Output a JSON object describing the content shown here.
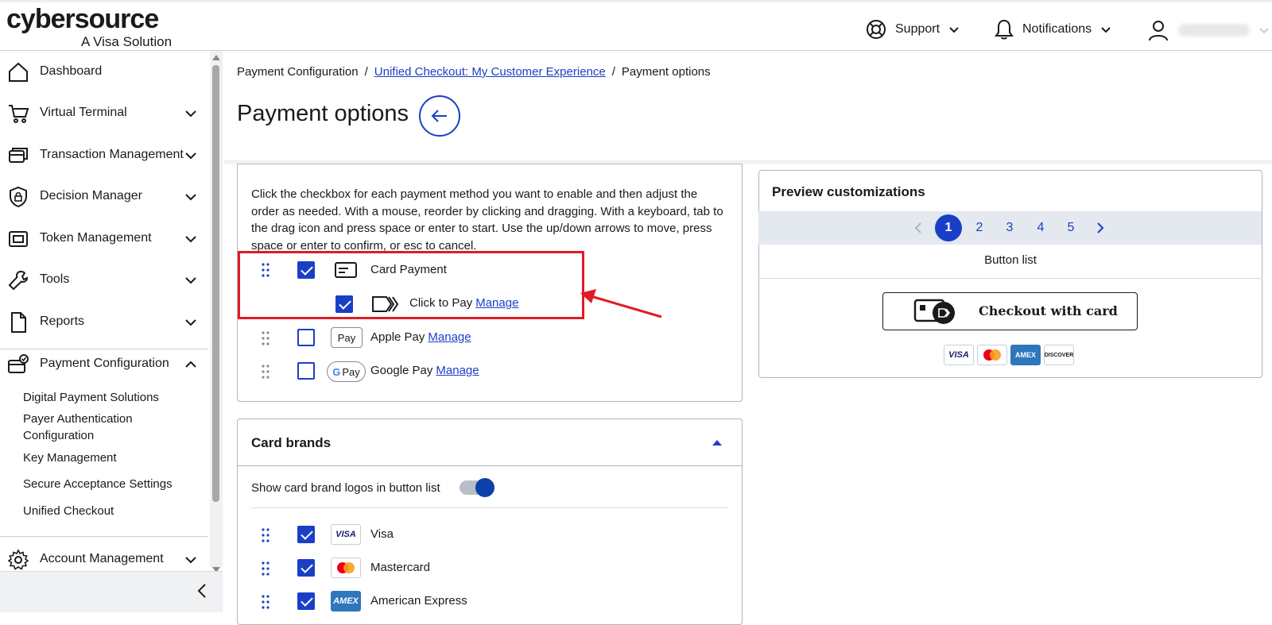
{
  "brand": {
    "name": "cybersource",
    "tagline": "A Visa Solution"
  },
  "topnav": {
    "support": "Support",
    "notifications": "Notifications"
  },
  "sidebar": {
    "items": [
      {
        "label": "Dashboard"
      },
      {
        "label": "Virtual Terminal"
      },
      {
        "label": "Transaction Management"
      },
      {
        "label": "Decision Manager"
      },
      {
        "label": "Token Management"
      },
      {
        "label": "Tools"
      },
      {
        "label": "Reports"
      },
      {
        "label": "Payment Configuration"
      },
      {
        "label": "Account Management"
      }
    ],
    "sub_items": [
      "Digital Payment Solutions",
      "Payer Authentication Configuration",
      "Key Management",
      "Secure Acceptance Settings",
      "Unified Checkout"
    ]
  },
  "breadcrumb": {
    "root": "Payment Configuration",
    "link": "Unified Checkout: My Customer Experience",
    "current": "Payment options"
  },
  "page_title": "Payment options",
  "methods": {
    "instructions": "Click the checkbox for each payment method you want to enable and then adjust the order as needed. With a mouse, reorder by clicking and dragging. With a keyboard, tab to the drag icon and press space or enter to start. Use the up/down arrows to move, press space or enter to confirm, or esc to cancel.",
    "card_payment": {
      "label": "Card Payment",
      "checked": true
    },
    "click_to_pay": {
      "label": "Click to Pay",
      "manage": "Manage",
      "checked": true
    },
    "apple_pay": {
      "label": "Apple Pay",
      "manage": "Manage",
      "checked": false,
      "badge": "Pay"
    },
    "google_pay": {
      "label": "Google Pay",
      "manage": "Manage",
      "checked": false,
      "badge": "Pay"
    }
  },
  "card_brands": {
    "title": "Card brands",
    "toggle_label": "Show card brand logos in button list",
    "toggle_on": true,
    "brands": [
      {
        "name": "Visa",
        "logo": "VISA",
        "checked": true
      },
      {
        "name": "Mastercard",
        "logo": "mastercard",
        "checked": true
      },
      {
        "name": "American Express",
        "logo": "AMEX",
        "checked": true
      }
    ]
  },
  "preview": {
    "title": "Preview customizations",
    "pages": [
      "1",
      "2",
      "3",
      "4",
      "5"
    ],
    "active_page": "1",
    "section_label": "Button list",
    "checkout_label": "Checkout with card",
    "mini_logos": [
      "VISA",
      "MC",
      "AMEX",
      "DISCOVER"
    ]
  },
  "colors": {
    "accent": "#1a3fc7",
    "highlight": "#e01b24"
  }
}
